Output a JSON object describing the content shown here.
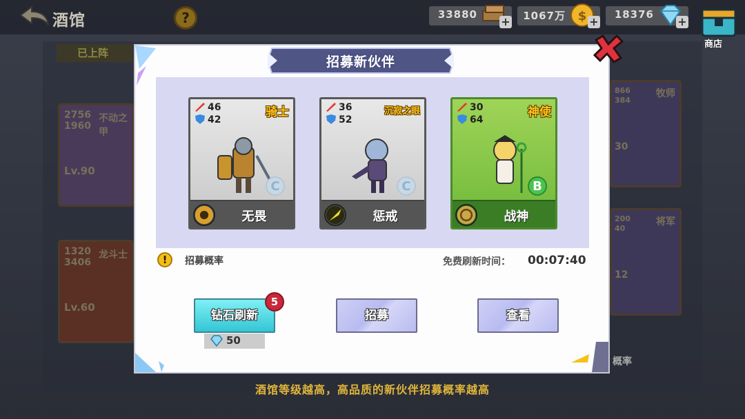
{
  "header": {
    "title": "酒馆",
    "back_icon": "back-arrow-icon",
    "help_icon": "question-icon",
    "help_text": "?"
  },
  "resources": [
    {
      "name": "wood",
      "value": "33880",
      "icon": "lumber-icon"
    },
    {
      "name": "gold",
      "value": "1067万",
      "icon": "gold-coin-icon"
    },
    {
      "name": "diamond",
      "value": "18376",
      "icon": "diamond-icon"
    }
  ],
  "shop": {
    "label": "商店",
    "icon": "shop-chest-icon"
  },
  "background": {
    "tab_label": "已上阵",
    "cards": [
      {
        "stats": [
          "2756",
          "1960"
        ],
        "name": "不动之甲",
        "level": "Lv.90"
      },
      {
        "stats": [
          "1320",
          "3406"
        ],
        "name": "龙斗士",
        "level": "Lv.60"
      },
      {
        "stats": [
          "866",
          "384"
        ],
        "name": "牧师",
        "level": "30"
      },
      {
        "stats": [
          "200",
          "40"
        ],
        "name": "将军",
        "level": "12"
      }
    ],
    "partial_text": "概率"
  },
  "dialog": {
    "title": "招募新伙伴",
    "close_icon": "close-x-icon",
    "cards": [
      {
        "atk": "46",
        "def": "42",
        "job": "骑士",
        "skill": "无畏",
        "grade": "C",
        "theme": "gray"
      },
      {
        "atk": "36",
        "def": "52",
        "job": "沉寂之眼",
        "skill": "惩戒",
        "grade": "C",
        "theme": "gray"
      },
      {
        "atk": "30",
        "def": "64",
        "job": "神使",
        "skill": "战神",
        "grade": "B",
        "theme": "green"
      }
    ],
    "rate_link": "招募概率",
    "info_icon": "!",
    "free_refresh_label": "免费刷新时间：",
    "free_refresh_timer": "00:07:40",
    "buttons": {
      "diamond_refresh": "钻石刷新",
      "diamond_refresh_badge": "5",
      "diamond_refresh_cost": "50",
      "recruit": "招募",
      "view": "查看"
    }
  },
  "bottom_tip": "酒馆等级越高，高品质的新伙伴招募概率越高",
  "colors": {
    "dialog_bg": "#fdfdfe",
    "cards_area": "#d8d8f2",
    "tip_text": "#e0b53a",
    "accent_cyan": "#34c6d5",
    "badge_red": "#c8283a"
  }
}
